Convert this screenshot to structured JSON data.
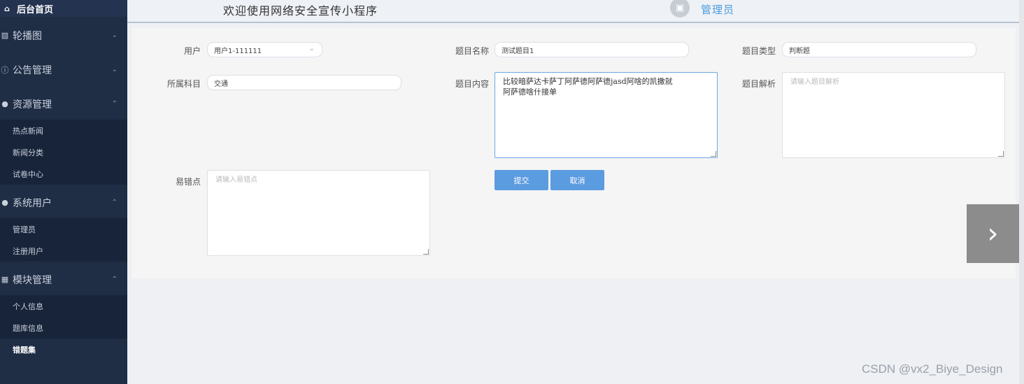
{
  "sidebar": {
    "home": "后台首页",
    "groups": [
      {
        "label": "轮播图",
        "icon": "image-icon"
      },
      {
        "label": "公告管理",
        "icon": "info-icon"
      },
      {
        "label": "资源管理",
        "icon": "location-icon"
      },
      {
        "label": "系统用户",
        "icon": "user-icon"
      },
      {
        "label": "模块管理",
        "icon": "grid-icon"
      }
    ],
    "resource_items": [
      "热点新闻",
      "新闻分类",
      "试卷中心"
    ],
    "user_items": [
      "管理员",
      "注册用户"
    ],
    "module_items": [
      "个人信息",
      "题库信息",
      "错题集"
    ]
  },
  "header": {
    "welcome": "欢迎使用网络安全宣传小程序",
    "role": "管理员"
  },
  "form": {
    "user_label": "用户",
    "user_value": "用户1-111111",
    "title_label": "题目名称",
    "title_value": "测试题目1",
    "type_label": "题目类型",
    "type_value": "判断题",
    "subject_label": "所属科目",
    "subject_value": "交通",
    "content_label": "题目内容",
    "content_line1": "比较暗萨达卡萨丁阿萨德阿萨德jasd阿啥的凯撒就",
    "content_line2": "阿萨德啥什接单",
    "analysis_label": "题目解析",
    "analysis_placeholder": "请输入题目解析",
    "error_label": "易错点",
    "error_placeholder": "请输入易错点",
    "submit": "提交",
    "cancel": "取消"
  },
  "watermark": "CSDN @vx2_Biye_Design"
}
